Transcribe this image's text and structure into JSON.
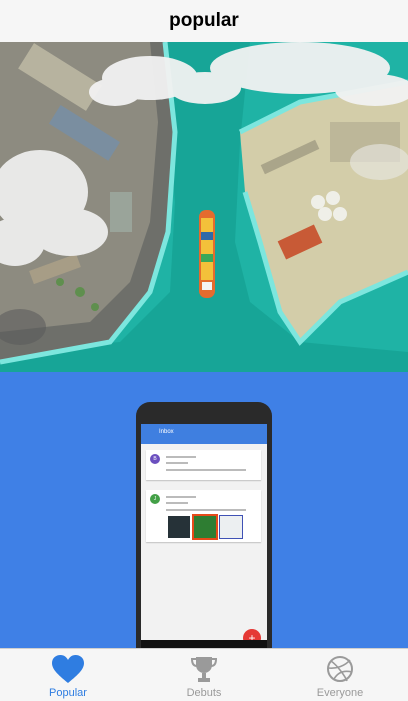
{
  "header": {
    "title": "popular"
  },
  "shots": [
    {
      "name": "harbor-illustration"
    },
    {
      "name": "phone-inbox-mockup",
      "app_title": "Inbox",
      "fab_label": "+",
      "cards": [
        {
          "avatar": "B",
          "avatar_color": "#6b4fbf"
        },
        {
          "avatar": "J",
          "avatar_color": "#43a047"
        }
      ]
    }
  ],
  "tabs": [
    {
      "label": "Popular",
      "icon": "heart-icon",
      "active": true,
      "color": "#2f7de1"
    },
    {
      "label": "Debuts",
      "icon": "trophy-icon",
      "active": false,
      "color": "#9a9a9a"
    },
    {
      "label": "Everyone",
      "icon": "dribbble-icon",
      "active": false,
      "color": "#9a9a9a"
    }
  ]
}
